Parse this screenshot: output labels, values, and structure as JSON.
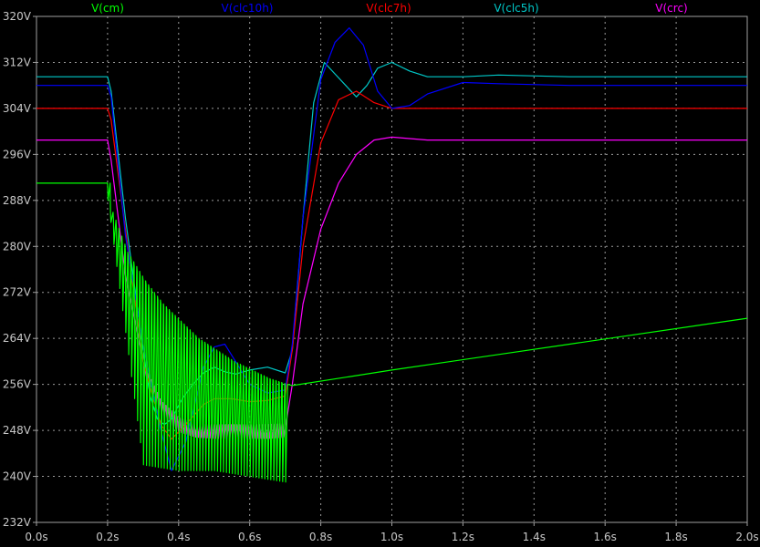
{
  "chart_data": {
    "type": "line",
    "xlim": [
      0,
      2.0
    ],
    "ylim": [
      232,
      320
    ],
    "grid": true,
    "legend_placement": "top",
    "x_ticks": [
      {
        "value": 0.0,
        "label": "0.0s"
      },
      {
        "value": 0.2,
        "label": "0.2s"
      },
      {
        "value": 0.4,
        "label": "0.4s"
      },
      {
        "value": 0.6,
        "label": "0.6s"
      },
      {
        "value": 0.8,
        "label": "0.8s"
      },
      {
        "value": 1.0,
        "label": "1.0s"
      },
      {
        "value": 1.2,
        "label": "1.2s"
      },
      {
        "value": 1.4,
        "label": "1.4s"
      },
      {
        "value": 1.6,
        "label": "1.6s"
      },
      {
        "value": 1.8,
        "label": "1.8s"
      },
      {
        "value": 2.0,
        "label": "2.0s"
      }
    ],
    "y_ticks": [
      {
        "value": 320,
        "label": "320V"
      },
      {
        "value": 312,
        "label": "312V"
      },
      {
        "value": 304,
        "label": "304V"
      },
      {
        "value": 296,
        "label": "296V"
      },
      {
        "value": 288,
        "label": "288V"
      },
      {
        "value": 280,
        "label": "280V"
      },
      {
        "value": 272,
        "label": "272V"
      },
      {
        "value": 264,
        "label": "264V"
      },
      {
        "value": 256,
        "label": "256V"
      },
      {
        "value": 248,
        "label": "248V"
      },
      {
        "value": 240,
        "label": "240V"
      },
      {
        "value": 232,
        "label": "232V"
      }
    ],
    "series": [
      {
        "name": "V(cm)",
        "color": "#00ff00",
        "x": [
          0,
          0.2,
          0.202,
          0.25,
          0.3,
          0.35,
          0.4,
          0.45,
          0.5,
          0.55,
          0.6,
          0.65,
          0.7,
          0.72,
          1.0,
          1.5,
          2.0
        ],
        "y": [
          291,
          291,
          287,
          279,
          274,
          270,
          267,
          264,
          262,
          260,
          258.5,
          257,
          256,
          255.8,
          258.5,
          263,
          267.5
        ],
        "ripple": {
          "x_start": 0.2,
          "x_end": 0.7,
          "period": 0.00833,
          "lower": [
            288,
            242,
            241,
            241,
            240,
            239
          ],
          "lower_x": [
            0.2,
            0.3,
            0.4,
            0.5,
            0.6,
            0.7
          ]
        }
      },
      {
        "name": "V(clc10h)",
        "color": "#0000ff",
        "x": [
          0,
          0.2,
          0.21,
          0.25,
          0.3,
          0.35,
          0.38,
          0.42,
          0.47,
          0.5,
          0.53,
          0.57,
          0.6,
          0.65,
          0.7,
          0.72,
          0.75,
          0.8,
          0.84,
          0.88,
          0.92,
          0.96,
          1.0,
          1.05,
          1.1,
          1.2,
          1.3,
          1.5,
          2.0
        ],
        "y": [
          308,
          308,
          306,
          282,
          263,
          248,
          241,
          246,
          259,
          262.5,
          263,
          259,
          256,
          254.5,
          255,
          263,
          285,
          309,
          315.5,
          318,
          315,
          307,
          304,
          304.5,
          306.5,
          308.5,
          308.3,
          308,
          308
        ]
      },
      {
        "name": "V(clc7h)",
        "color": "#ff0000",
        "x": [
          0,
          0.2,
          0.21,
          0.25,
          0.3,
          0.35,
          0.38,
          0.42,
          0.47,
          0.5,
          0.55,
          0.6,
          0.65,
          0.7,
          0.72,
          0.75,
          0.8,
          0.85,
          0.9,
          0.95,
          1.0,
          1.1,
          1.5,
          2.0
        ],
        "y": [
          304,
          304,
          302,
          283,
          260,
          249,
          246.5,
          249,
          252.5,
          253.5,
          253.5,
          253,
          253.2,
          254,
          262,
          280,
          298,
          305.5,
          307,
          305,
          304,
          304,
          304,
          304
        ]
      },
      {
        "name": "V(clc5h)",
        "color": "#00c8c8",
        "x": [
          0,
          0.2,
          0.21,
          0.25,
          0.3,
          0.32,
          0.34,
          0.36,
          0.38,
          0.41,
          0.44,
          0.47,
          0.5,
          0.53,
          0.56,
          0.6,
          0.65,
          0.7,
          0.72,
          0.75,
          0.78,
          0.81,
          0.84,
          0.87,
          0.9,
          0.93,
          0.96,
          1.0,
          1.05,
          1.1,
          1.2,
          1.3,
          1.5,
          2.0
        ],
        "y": [
          309.5,
          309.5,
          307,
          285,
          262,
          254,
          250,
          249,
          250,
          253.5,
          256,
          258,
          259,
          258.2,
          257.8,
          258.5,
          259,
          258,
          262,
          285,
          305,
          312,
          310,
          308,
          306,
          308,
          311,
          312,
          310.5,
          309.5,
          309.5,
          309.8,
          309.5,
          309.5
        ]
      },
      {
        "name": "V(crc)",
        "color": "#ff00ff",
        "x": [
          0,
          0.2,
          0.21,
          0.25,
          0.3,
          0.35,
          0.4,
          0.45,
          0.5,
          0.55,
          0.6,
          0.65,
          0.7,
          0.72,
          0.75,
          0.8,
          0.85,
          0.9,
          0.95,
          1.0,
          1.1,
          1.5,
          2.0
        ],
        "y": [
          298.5,
          298.5,
          295,
          275,
          259,
          252,
          249,
          248,
          247.8,
          247.8,
          247.8,
          247.8,
          248,
          256,
          270,
          283,
          291,
          296,
          298.5,
          299,
          298.5,
          298.5,
          298.5
        ],
        "ripple": {
          "x_start": 0.3,
          "x_end": 0.7,
          "amplitude": 1.2,
          "period": 0.008
        }
      }
    ]
  }
}
